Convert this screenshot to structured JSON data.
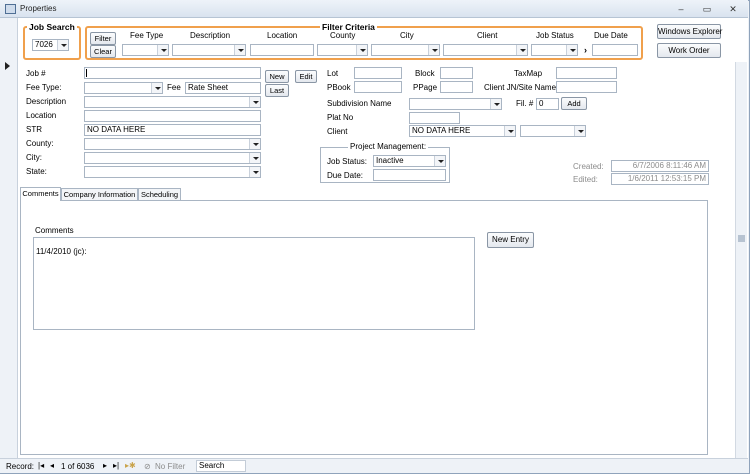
{
  "window": {
    "title": "Properties",
    "minimize": "–",
    "restore": "▭",
    "close": "✕"
  },
  "job_search": {
    "title": "Job Search",
    "value": "7026"
  },
  "filter": {
    "title": "Filter Criteria",
    "filter_btn": "Filter",
    "clear_btn": "Clear",
    "cols": [
      "Fee Type",
      "Description",
      "Location",
      "County",
      "City",
      "Client",
      "Job Status",
      "Due Date"
    ]
  },
  "buttons": {
    "explorer": "Windows Explorer",
    "work_order": "Work Order",
    "new": "New",
    "edit": "Edit",
    "last": "Last",
    "add": "Add",
    "new_entry": "New Entry"
  },
  "form": {
    "job_num": "Job #",
    "fee_type": "Fee Type:",
    "fee": "Fee",
    "fee_value": "Rate Sheet",
    "description": "Description",
    "location": "Location",
    "str": "STR",
    "str_value": "NO DATA HERE",
    "county": "County:",
    "city": "City:",
    "state": "State:"
  },
  "right": {
    "lot": "Lot",
    "block": "Block",
    "taxmap": "TaxMap",
    "pbook": "PBook",
    "ppage": "PPage",
    "client_jn": "Client JN/Site Name",
    "subdivision": "Subdivision Name",
    "fil": "Fil. #",
    "fil_value": "0",
    "plat": "Plat No",
    "client": "Client",
    "client_value": "NO DATA HERE"
  },
  "project": {
    "title": "Project Management:",
    "status_label": "Job Status:",
    "status_value": "Inactive",
    "due_label": "Due Date:"
  },
  "meta": {
    "created_label": "Created:",
    "created": "6/7/2006 8:11:46 AM",
    "edited_label": "Edited:",
    "edited": "1/6/2011 12:53:15 PM"
  },
  "tabs": [
    "Comments",
    "Company Information",
    "Scheduling"
  ],
  "comments": {
    "label": "Comments",
    "text": "11/4/2010 (jc):"
  },
  "status": {
    "record": "Record:",
    "position": "1 of 6036",
    "nofilter": "No Filter",
    "search": "Search"
  }
}
